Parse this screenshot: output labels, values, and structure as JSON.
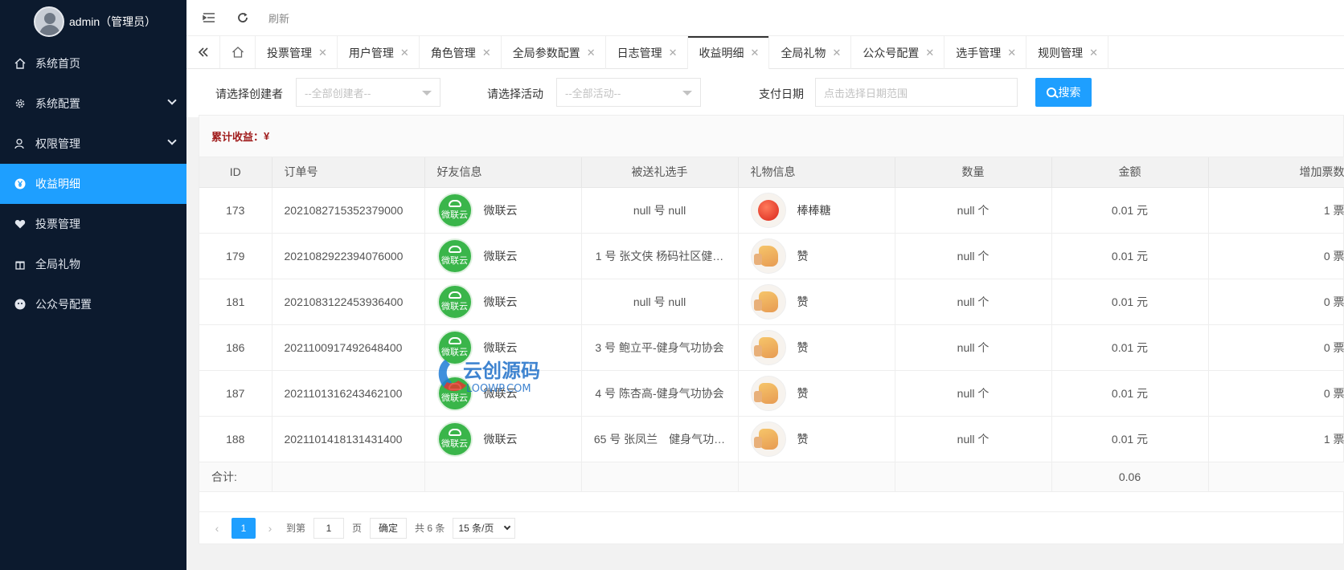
{
  "user": {
    "name": "admin（管理员）"
  },
  "sidebar": {
    "items": [
      {
        "label": "系统首页",
        "icon": "home-icon"
      },
      {
        "label": "系统配置",
        "icon": "gear-icon"
      },
      {
        "label": "权限管理",
        "icon": "user-icon"
      },
      {
        "label": "收益明细",
        "icon": "yen-icon"
      },
      {
        "label": "投票管理",
        "icon": "heart-icon"
      },
      {
        "label": "全局礼物",
        "icon": "gift-icon"
      },
      {
        "label": "公众号配置",
        "icon": "wechat-icon"
      }
    ]
  },
  "header": {
    "refresh_label": "刷新"
  },
  "tabs": [
    {
      "label": "投票管理"
    },
    {
      "label": "用户管理"
    },
    {
      "label": "角色管理"
    },
    {
      "label": "全局参数配置"
    },
    {
      "label": "日志管理"
    },
    {
      "label": "收益明细"
    },
    {
      "label": "全局礼物"
    },
    {
      "label": "公众号配置"
    },
    {
      "label": "选手管理"
    },
    {
      "label": "规则管理"
    }
  ],
  "filters": {
    "creator_label": "请选择创建者",
    "creator_value": "--全部创建者--",
    "activity_label": "请选择活动",
    "activity_value": "--全部活动--",
    "date_label": "支付日期",
    "date_placeholder": "点击选择日期范围",
    "search_label": "搜索"
  },
  "summary": {
    "label": "累计收益：",
    "value": "¥"
  },
  "table": {
    "headers": [
      "ID",
      "订单号",
      "好友信息",
      "被送礼选手",
      "礼物信息",
      "数量",
      "金额",
      "增加票数"
    ],
    "rows": [
      {
        "id": "173",
        "order": "2021082715352379000",
        "friend_logo": "微联云",
        "friend": "微联云",
        "player": "null 号 null",
        "gift_type": "candy",
        "gift": "棒棒糖",
        "qty": "null 个",
        "amount": "0.01 元",
        "votes": "1 票"
      },
      {
        "id": "179",
        "order": "2021082922394076000",
        "friend_logo": "微联云",
        "friend": "微联云",
        "player": "1 号 张文侠 杨码社区健…",
        "gift_type": "thumb",
        "gift": "赞",
        "qty": "null 个",
        "amount": "0.01 元",
        "votes": "0 票"
      },
      {
        "id": "181",
        "order": "2021083122453936400",
        "friend_logo": "微联云",
        "friend": "微联云",
        "player": "null 号 null",
        "gift_type": "thumb",
        "gift": "赞",
        "qty": "null 个",
        "amount": "0.01 元",
        "votes": "0 票"
      },
      {
        "id": "186",
        "order": "2021100917492648400",
        "friend_logo": "微联云",
        "friend": "微联云",
        "player": "3 号 鲍立平-健身气功协会",
        "gift_type": "thumb",
        "gift": "赞",
        "qty": "null 个",
        "amount": "0.01 元",
        "votes": "0 票"
      },
      {
        "id": "187",
        "order": "2021101316243462100",
        "friend_logo": "微联云",
        "friend": "微联云",
        "player": "4 号 陈杏高-健身气功协会",
        "gift_type": "thumb",
        "gift": "赞",
        "qty": "null 个",
        "amount": "0.01 元",
        "votes": "0 票"
      },
      {
        "id": "188",
        "order": "2021101418131431400",
        "friend_logo": "微联云",
        "friend": "微联云",
        "player": "65 号 张凤兰　健身气功…",
        "gift_type": "thumb",
        "gift": "赞",
        "qty": "null 个",
        "amount": "0.01 元",
        "votes": "1 票"
      }
    ],
    "sum_label": "合计:",
    "sum_amount": "0.06"
  },
  "pager": {
    "current": "1",
    "goto_label": "到第",
    "goto_value": "1",
    "page_unit": "页",
    "confirm": "确定",
    "total": "共 6 条",
    "page_size": "15 条/页"
  },
  "watermark": {
    "title": "云创源码",
    "url": "LOOWP.COM"
  },
  "colors": {
    "sidebar_bg": "#0c1a2e",
    "accent": "#1e9fff",
    "summary_text": "#a01c1c"
  }
}
